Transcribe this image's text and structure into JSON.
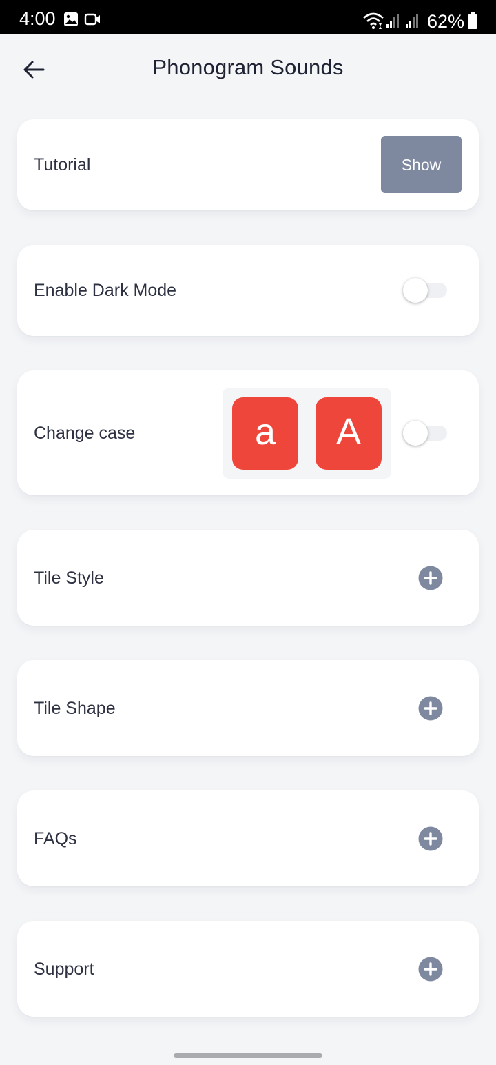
{
  "status_bar": {
    "time": "4:00",
    "battery": "62%",
    "icons": [
      "gallery-icon",
      "video-camera-icon",
      "wifi-icon",
      "signal-icon",
      "signal-icon",
      "battery-icon"
    ]
  },
  "header": {
    "title": "Phonogram Sounds",
    "back_icon": "arrow-left-icon"
  },
  "settings": {
    "tutorial": {
      "label": "Tutorial",
      "button_label": "Show"
    },
    "dark_mode": {
      "label": "Enable Dark Mode",
      "enabled": false
    },
    "change_case": {
      "label": "Change case",
      "lowercase_tile": "a",
      "uppercase_tile": "A",
      "enabled": false
    },
    "tile_style": {
      "label": "Tile Style",
      "icon": "plus-circle-icon"
    },
    "tile_shape": {
      "label": "Tile Shape",
      "icon": "plus-circle-icon"
    },
    "faqs": {
      "label": "FAQs",
      "icon": "plus-circle-icon"
    },
    "support": {
      "label": "Support",
      "icon": "plus-circle-icon"
    }
  },
  "colors": {
    "background": "#f4f5f7",
    "card": "#ffffff",
    "button": "#7e89a0",
    "tile": "#ef463c",
    "plus_icon": "#7e89a0",
    "text": "#2d3142"
  }
}
